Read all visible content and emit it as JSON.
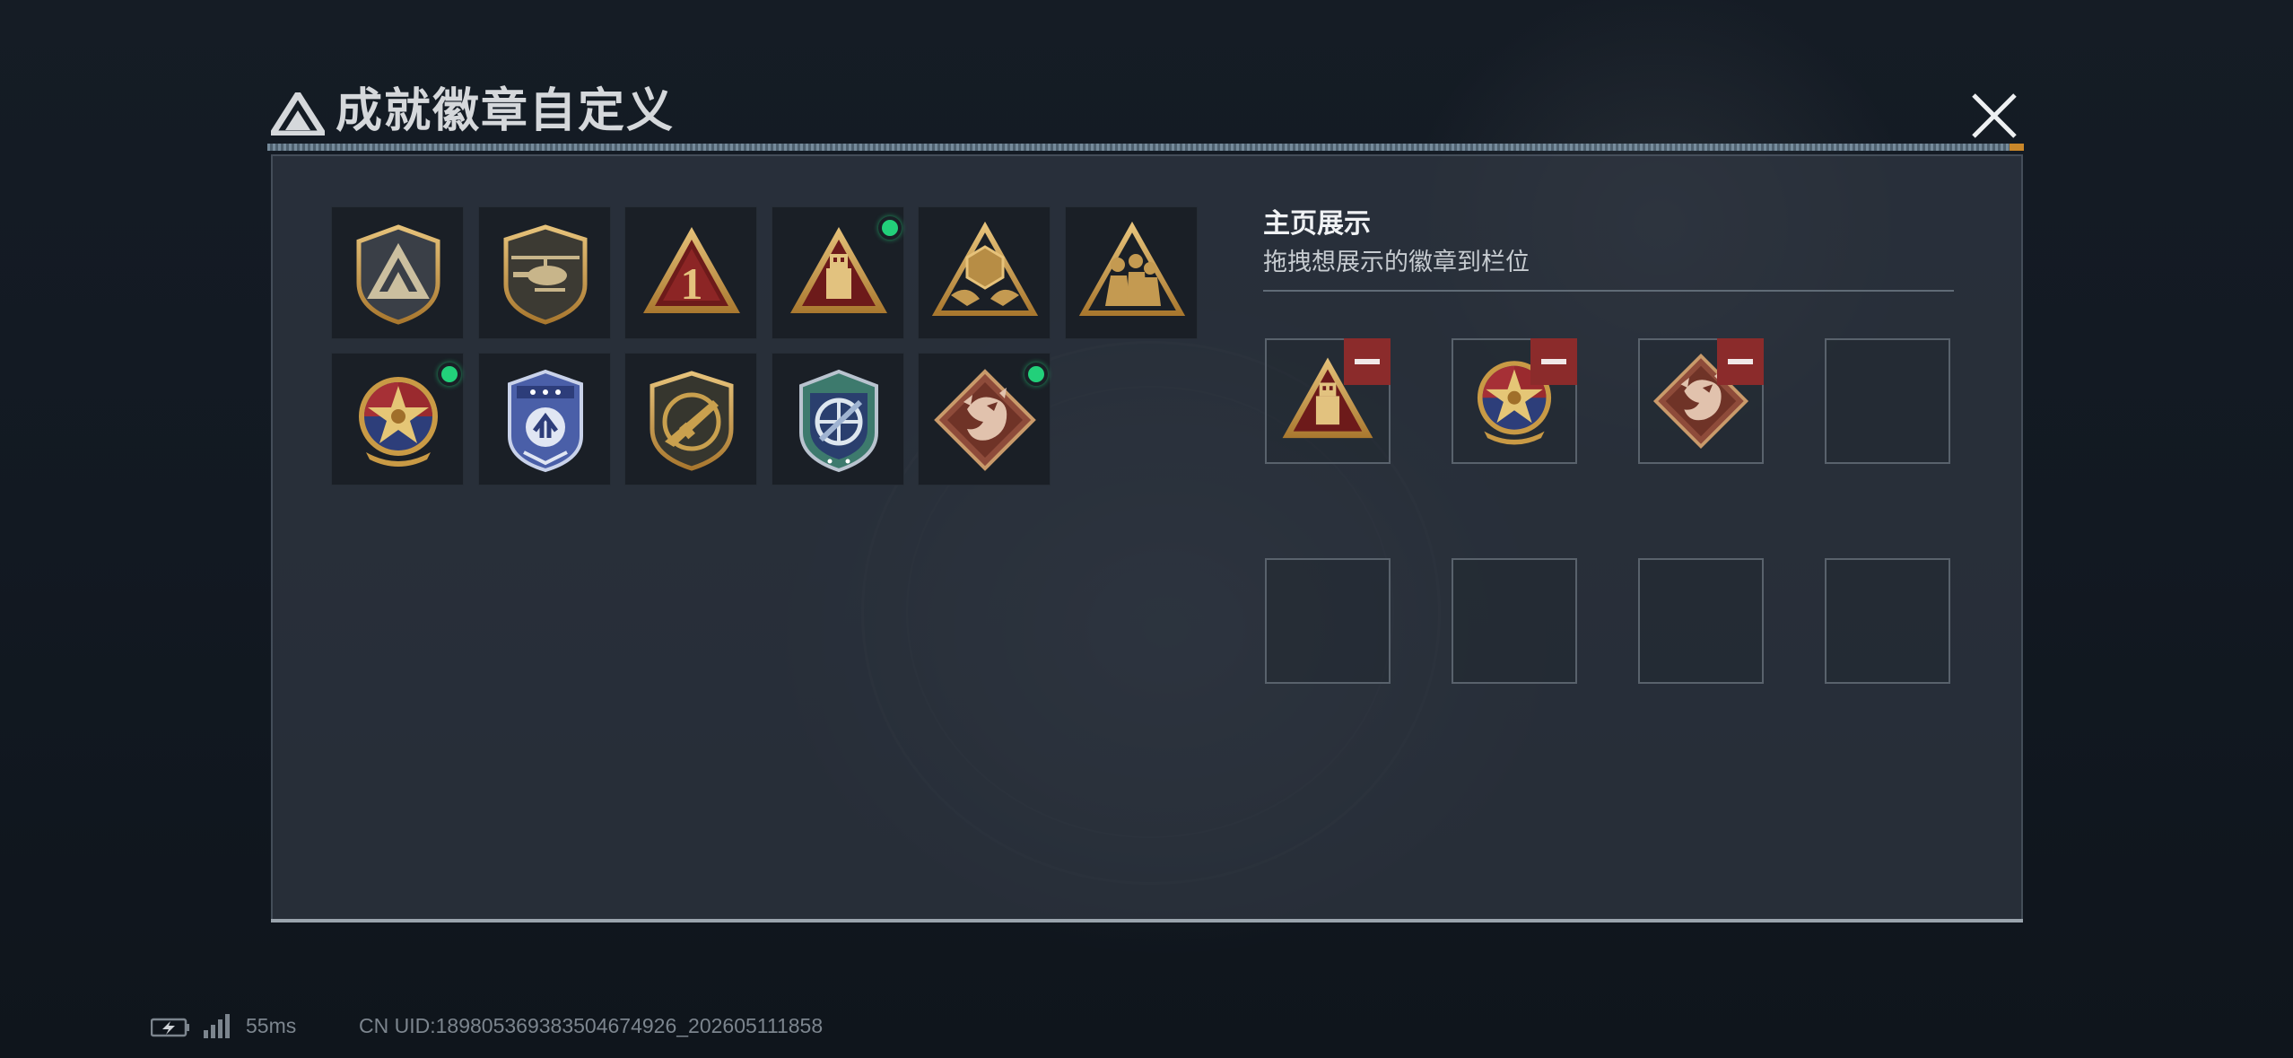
{
  "header": {
    "title": "成就徽章自定义",
    "code_text": "⠀⠀⠀⠀⠀⠀⠀⠀⠀⠀⠀"
  },
  "badges": [
    {
      "icon": "triangle-emblem-shield-icon",
      "new": false
    },
    {
      "icon": "helicopter-shield-icon",
      "new": false
    },
    {
      "icon": "number-one-triangle-icon",
      "new": false
    },
    {
      "icon": "usb-drive-triangle-icon",
      "new": true
    },
    {
      "icon": "hands-globe-triangle-icon",
      "new": false
    },
    {
      "icon": "soldiers-triangle-icon",
      "new": false
    },
    {
      "icon": "star-medal-icon",
      "new": true
    },
    {
      "icon": "police-badge-icon",
      "new": false
    },
    {
      "icon": "rifle-shield-icon",
      "new": false
    },
    {
      "icon": "target-shield-icon",
      "new": false
    },
    {
      "icon": "dragon-diamond-icon",
      "new": true
    }
  ],
  "showcase": {
    "title": "主页展示",
    "subtitle": "拖拽想展示的徽章到栏位",
    "slots": [
      {
        "icon": "usb-drive-triangle-icon",
        "filled": true
      },
      {
        "icon": "star-medal-icon",
        "filled": true
      },
      {
        "icon": "dragon-diamond-icon",
        "filled": true
      },
      {
        "icon": "",
        "filled": false
      },
      {
        "icon": "",
        "filled": false
      },
      {
        "icon": "",
        "filled": false
      },
      {
        "icon": "",
        "filled": false
      },
      {
        "icon": "",
        "filled": false
      }
    ]
  },
  "status_bar": {
    "ping": "55ms",
    "uid": "CN UID:18980536938350467492б_202605111858"
  },
  "colors": {
    "new_dot": "#22d07a",
    "remove_button": "#8b2b2b",
    "gold": "#c9a04e"
  }
}
